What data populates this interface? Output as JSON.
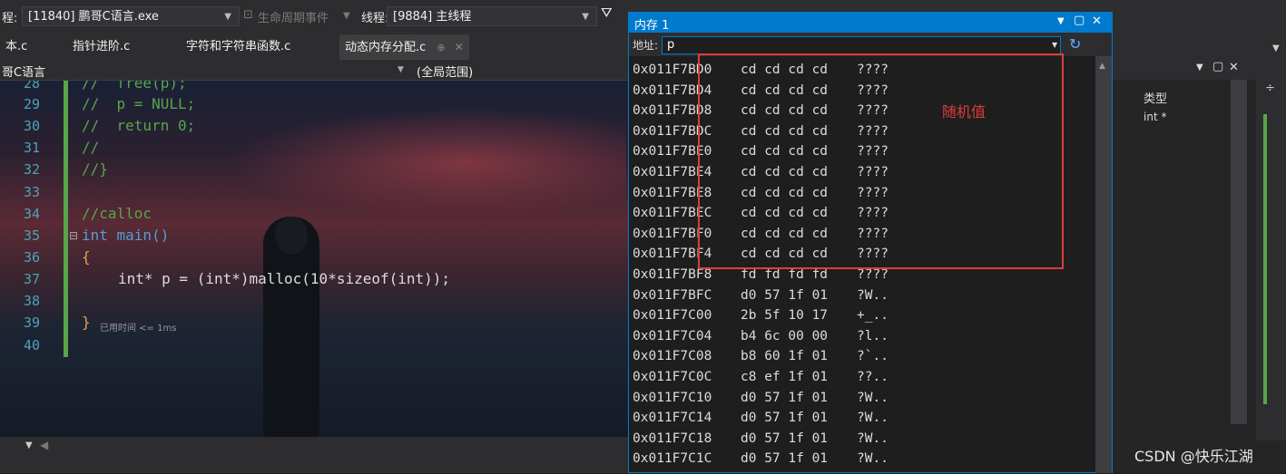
{
  "toolbar": {
    "process_prefix": "程:",
    "process_value": "[11840] 鹏哥C语言.exe",
    "lifecycle_label": "生命周期事件",
    "thread_label": "线程:",
    "thread_value": "[9884] 主线程"
  },
  "tabs": [
    {
      "label": "本.c"
    },
    {
      "label": "指针进阶.c"
    },
    {
      "label": "字符和字符串函数.c"
    },
    {
      "label": "动态内存分配.c"
    }
  ],
  "nav": {
    "project": "哥C语言",
    "scope": "(全局范围)"
  },
  "editor": {
    "lines": [
      {
        "num": "28",
        "code": "//  free(p);"
      },
      {
        "num": "29",
        "code": "//  p = NULL;"
      },
      {
        "num": "30",
        "code": "//  return 0;"
      },
      {
        "num": "31",
        "code": "//"
      },
      {
        "num": "32",
        "code": "//}"
      },
      {
        "num": "33",
        "code": ""
      },
      {
        "num": "34",
        "code": "//calloc"
      },
      {
        "num": "35",
        "code": "int main()"
      },
      {
        "num": "36",
        "code": "{"
      },
      {
        "num": "37",
        "code": "int* p = (int*)malloc(10*sizeof(int));"
      },
      {
        "num": "38",
        "code": ""
      },
      {
        "num": "39",
        "code": "}"
      },
      {
        "num": "40",
        "code": ""
      }
    ],
    "elapsed_hint": "已用时间 <= 1ms"
  },
  "memory": {
    "title": "内存 1",
    "address_label": "地址:",
    "address_value": "p",
    "rows": [
      {
        "addr": "0x011F7BD0",
        "hex": "cd cd cd cd",
        "chars": "????"
      },
      {
        "addr": "0x011F7BD4",
        "hex": "cd cd cd cd",
        "chars": "????"
      },
      {
        "addr": "0x011F7BD8",
        "hex": "cd cd cd cd",
        "chars": "????"
      },
      {
        "addr": "0x011F7BDC",
        "hex": "cd cd cd cd",
        "chars": "????"
      },
      {
        "addr": "0x011F7BE0",
        "hex": "cd cd cd cd",
        "chars": "????"
      },
      {
        "addr": "0x011F7BE4",
        "hex": "cd cd cd cd",
        "chars": "????"
      },
      {
        "addr": "0x011F7BE8",
        "hex": "cd cd cd cd",
        "chars": "????"
      },
      {
        "addr": "0x011F7BEC",
        "hex": "cd cd cd cd",
        "chars": "????"
      },
      {
        "addr": "0x011F7BF0",
        "hex": "cd cd cd cd",
        "chars": "????"
      },
      {
        "addr": "0x011F7BF4",
        "hex": "cd cd cd cd",
        "chars": "????"
      },
      {
        "addr": "0x011F7BF8",
        "hex": "fd fd fd fd",
        "chars": "????"
      },
      {
        "addr": "0x011F7BFC",
        "hex": "d0 57 1f 01",
        "chars": "?W.."
      },
      {
        "addr": "0x011F7C00",
        "hex": "2b 5f 10 17",
        "chars": "+_.."
      },
      {
        "addr": "0x011F7C04",
        "hex": "b4 6c 00 00",
        "chars": "?l.."
      },
      {
        "addr": "0x011F7C08",
        "hex": "b8 60 1f 01",
        "chars": "?`.."
      },
      {
        "addr": "0x011F7C0C",
        "hex": "c8 ef 1f 01",
        "chars": "??.."
      },
      {
        "addr": "0x011F7C10",
        "hex": "d0 57 1f 01",
        "chars": "?W.."
      },
      {
        "addr": "0x011F7C14",
        "hex": "d0 57 1f 01",
        "chars": "?W.."
      },
      {
        "addr": "0x011F7C18",
        "hex": "d0 57 1f 01",
        "chars": "?W.."
      },
      {
        "addr": "0x011F7C1C",
        "hex": "d0 57 1f 01",
        "chars": "?W.."
      }
    ]
  },
  "annotation": {
    "text": "随机值",
    "color": "#e03c3c"
  },
  "right_panel": {
    "type_header": "类型",
    "type_value": "int *"
  },
  "watermark": "CSDN @快乐江湖",
  "colors": {
    "accent": "#007acc",
    "comment": "#57a64a",
    "keyword": "#569cd6"
  }
}
